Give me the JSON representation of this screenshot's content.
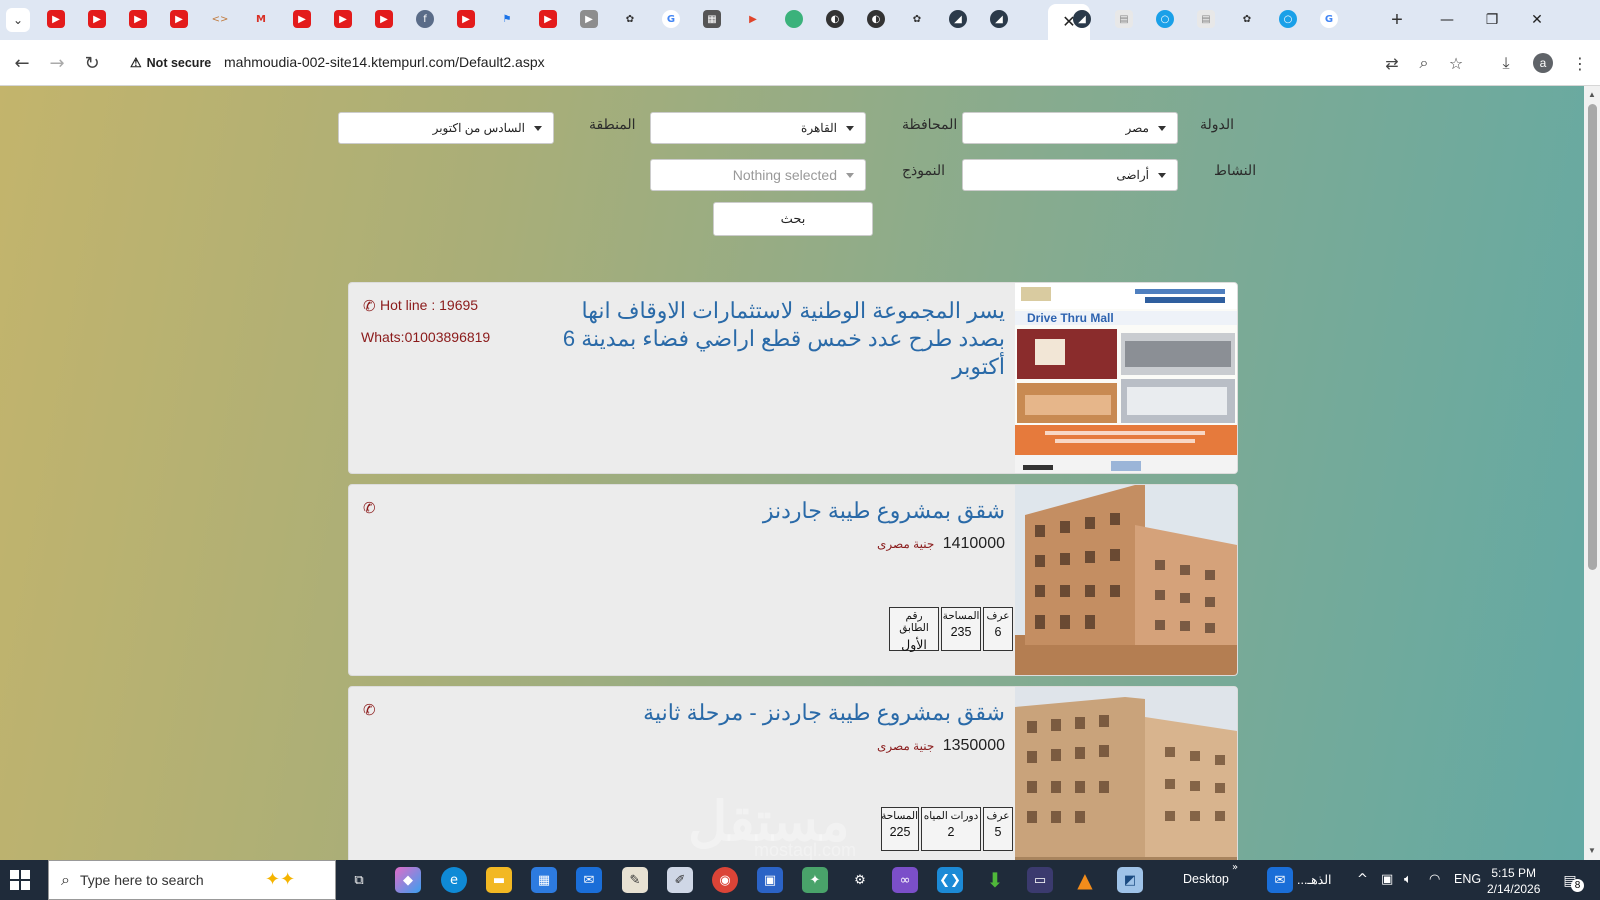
{
  "browser": {
    "active_tab_close": "✕",
    "new_tab": "+",
    "minimize": "—",
    "restore": "❐",
    "close": "✕",
    "security_label": "Not secure",
    "url": "mahmoudia-002-site14.ktempurl.com/Default2.aspx",
    "profile_initial": "a"
  },
  "filters": {
    "country_label": "الدولة",
    "country_value": "مصر",
    "governorate_label": "المحافظة",
    "governorate_value": "القاهرة",
    "region_label": "المنطقة",
    "region_value": "السادس من اكتوبر",
    "activity_label": "النشاط",
    "activity_value": "أراضى",
    "model_label": "النموذج",
    "model_value": "Nothing selected",
    "search_label": "بحث"
  },
  "listings": [
    {
      "title": "يسر المجموعة الوطنية لاستثمارات الاوقاف انها بصدد طرح عدد خمس قطع اراضي فضاء بمدينة 6 أكتوبر",
      "hotline": "Hot line : 19695",
      "whats": "Whats:01003896819",
      "image_label": "Drive Thru Mall"
    },
    {
      "title": "شقق بمشروع طيبة جاردنز",
      "price": "1410000",
      "currency": "جنية مصرى",
      "specs": [
        {
          "key": "عرف",
          "value": "6"
        },
        {
          "key": "المساحة",
          "value": "235"
        },
        {
          "key": "رقم الطابق",
          "value": "الأول"
        }
      ]
    },
    {
      "title": "شقق بمشروع طيبة جاردنز - مرحلة ثانية",
      "price": "1350000",
      "currency": "جنية مصرى",
      "specs": [
        {
          "key": "عرف",
          "value": "5"
        },
        {
          "key": "دورات المياه",
          "value": "2"
        },
        {
          "key": "المساحة",
          "value": "225"
        }
      ]
    }
  ],
  "watermark": {
    "arabic": "مستقل",
    "latin": "mostaql.com"
  },
  "taskbar": {
    "search_placeholder": "Type here to search",
    "desktop_label": "Desktop",
    "outlook_label": "الذهـ...",
    "lang": "ENG",
    "time": "5:15 PM",
    "date": "2/14/2026",
    "notifications": "8"
  },
  "colors": {
    "title": "#2a6aa8",
    "accent_red": "#8b1a1a",
    "taskbar": "#1f2b3a"
  }
}
